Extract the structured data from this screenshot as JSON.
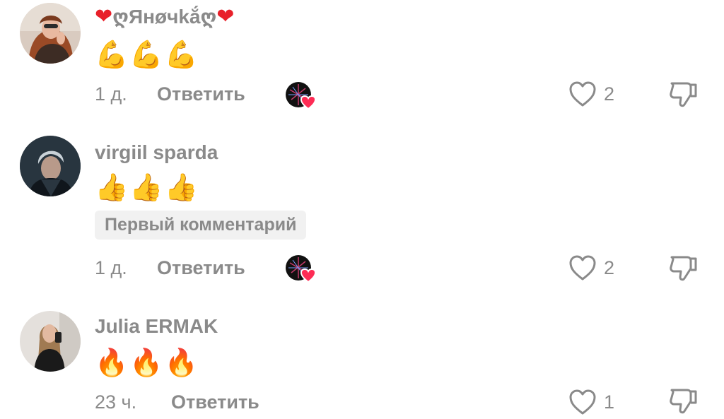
{
  "comments": [
    {
      "username": "ღЯнøчkắღ",
      "emojis": "💪💪💪",
      "time": "1 д.",
      "reply_label": "Ответить",
      "likes": "2"
    },
    {
      "username": "virgiil sparda",
      "emojis": "👍👍👍",
      "badge": "Первый комментарий",
      "time": "1 д.",
      "reply_label": "Ответить",
      "likes": "2"
    },
    {
      "username": "Julia ERMAK",
      "emojis": "🔥🔥🔥",
      "time": "23 ч.",
      "reply_label": "Ответить",
      "likes": "1"
    }
  ],
  "icons": {
    "like": "heart-outline-icon",
    "dislike": "thumbs-down-outline-icon",
    "creator_liked": "creator-liked-heart-icon"
  },
  "colors": {
    "text_secondary": "#8a8a8a",
    "heart_red": "#e8202a",
    "creator_heart": "#fe2c55"
  }
}
